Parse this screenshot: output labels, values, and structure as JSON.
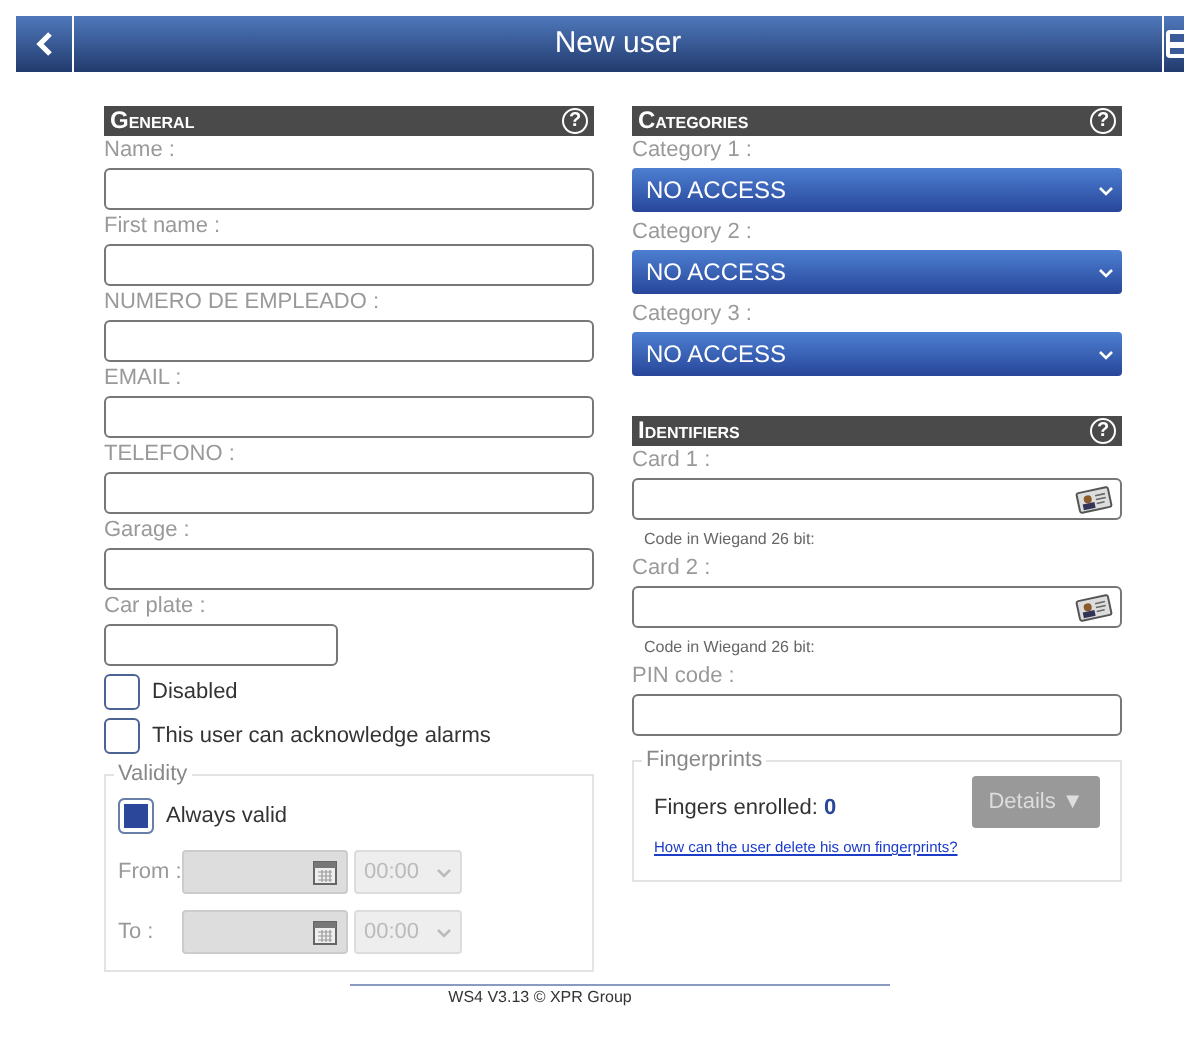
{
  "header": {
    "title": "New user"
  },
  "general": {
    "title": "General",
    "help": "?",
    "fields": [
      {
        "label": "Name :",
        "kind": "wide"
      },
      {
        "label": "First name :",
        "kind": "wide"
      },
      {
        "label": "NUMERO DE EMPLEADO :",
        "kind": "wide"
      },
      {
        "label": "EMAIL :",
        "kind": "wide"
      },
      {
        "label": "TELEFONO :",
        "kind": "wide"
      },
      {
        "label": "Garage :",
        "kind": "wide"
      },
      {
        "label": "Car plate :",
        "kind": "short"
      }
    ],
    "checkboxes": [
      {
        "label": "Disabled",
        "checked": false
      },
      {
        "label": "This user can acknowledge alarms",
        "checked": false
      }
    ],
    "validity": {
      "legend": "Validity",
      "always_valid": {
        "label": "Always valid",
        "checked": true
      },
      "rows": [
        {
          "label": "From :",
          "time": "00:00",
          "disabled": true
        },
        {
          "label": "To :",
          "time": "00:00",
          "disabled": true
        }
      ]
    }
  },
  "categories": {
    "title": "Categories",
    "help": "?",
    "items": [
      {
        "label": "Category 1 :",
        "value": "NO ACCESS"
      },
      {
        "label": "Category 2 :",
        "value": "NO ACCESS"
      },
      {
        "label": "Category 3 :",
        "value": "NO ACCESS"
      }
    ]
  },
  "identifiers": {
    "title": "Identifiers",
    "help": "?",
    "cards": [
      {
        "label": "Card 1 :",
        "hint": "Code in Wiegand 26 bit:"
      },
      {
        "label": "Card 2 :",
        "hint": "Code in Wiegand 26 bit:"
      }
    ],
    "pin": {
      "label": "PIN code :"
    },
    "fingerprints": {
      "legend": "Fingerprints",
      "enrolled_label": "Fingers enrolled:",
      "enrolled_count": "0",
      "details_button": "Details ▼",
      "details_disabled": true,
      "help_link": "How can the user delete his own fingerprints?"
    }
  },
  "footer": "WS4 V3.13 © XPR Group"
}
